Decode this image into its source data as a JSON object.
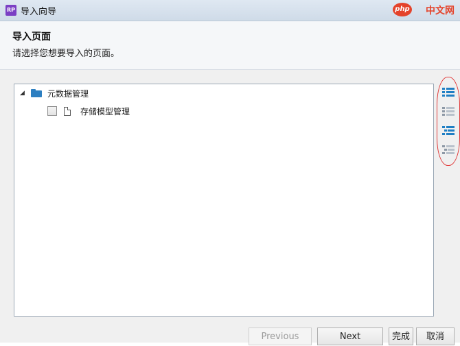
{
  "window": {
    "title": "导入向导",
    "app_icon": "RP"
  },
  "watermark": {
    "badge": "php",
    "brand": "中文网"
  },
  "header": {
    "title": "导入页面",
    "subtitle": "请选择您想要导入的页面。"
  },
  "tree": {
    "root": {
      "label": "元数据管理",
      "expanded": true,
      "icon": "folder-icon"
    },
    "children": [
      {
        "label": "存储模型管理",
        "checked": false,
        "icon": "page-icon"
      }
    ]
  },
  "side_tools": [
    {
      "name": "check-all-icon",
      "color": "#1f7fc4"
    },
    {
      "name": "uncheck-all-icon",
      "color": "#9aa7b5"
    },
    {
      "name": "check-children-icon",
      "color": "#1f7fc4"
    },
    {
      "name": "uncheck-children-icon",
      "color": "#9aa7b5"
    }
  ],
  "footer": {
    "previous_label": "Previous",
    "next_label": "Next",
    "finish_label": "完成",
    "cancel_label": "取消"
  }
}
